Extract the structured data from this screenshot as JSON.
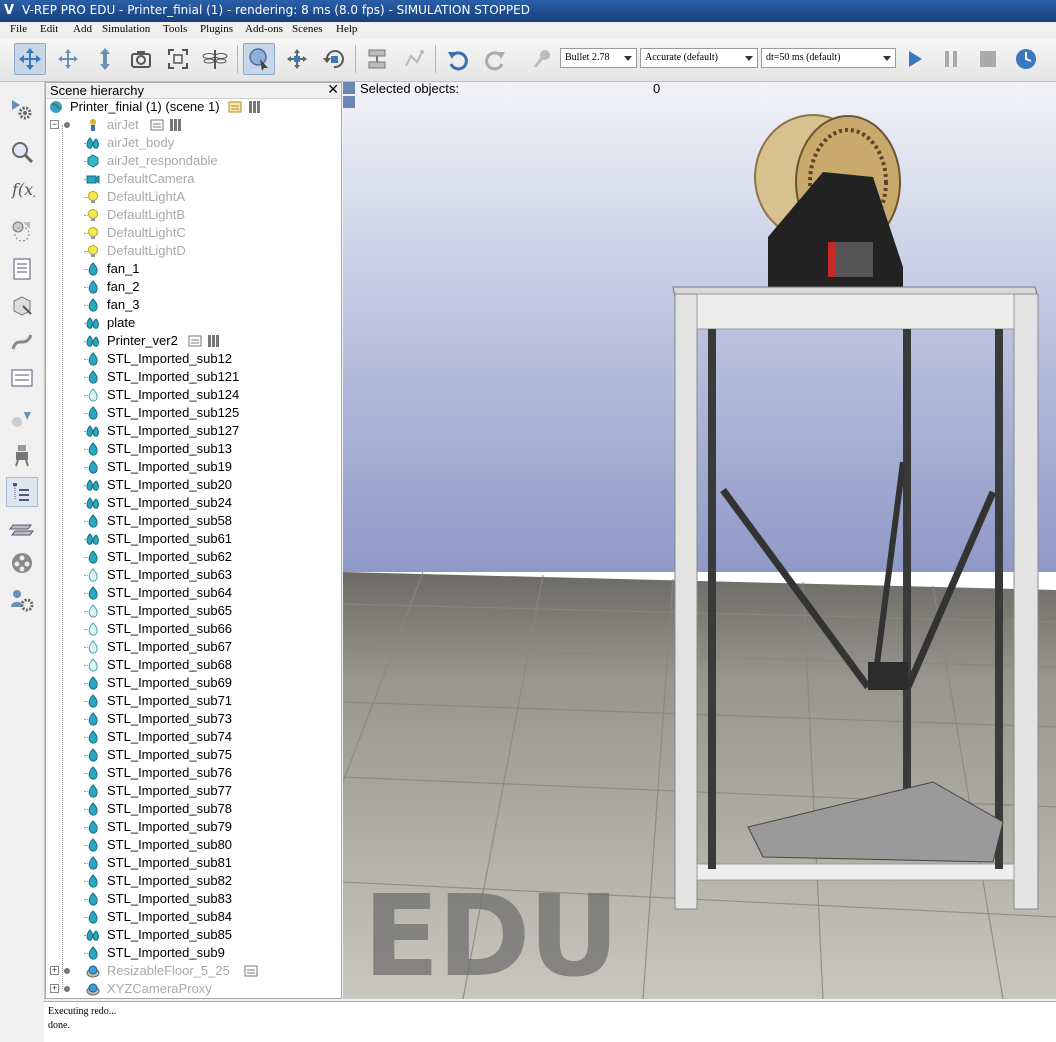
{
  "window": {
    "title": "V-REP PRO EDU - Printer_finial (1) - rendering: 8 ms (8.0 fps) - SIMULATION STOPPED"
  },
  "menu": [
    "File",
    "Edit",
    "Add",
    "Simulation",
    "Tools",
    "Plugins",
    "Add-ons",
    "Scenes",
    "Help"
  ],
  "toolbar": {
    "engine": "Bullet 2.78",
    "accuracy": "Accurate (default)",
    "timestep": "dt=50 ms (default)"
  },
  "hierarchy": {
    "title": "Scene hierarchy",
    "close": "✕",
    "scene_label": "Printer_finial (1) (scene 1)",
    "items": [
      {
        "name": "airJet",
        "icon": "dummy",
        "dim": true,
        "level": 1
      },
      {
        "name": "airJet_body",
        "icon": "shape-multi",
        "dim": true,
        "level": 2
      },
      {
        "name": "airJet_respondable",
        "icon": "cube",
        "dim": true,
        "level": 2
      },
      {
        "name": "DefaultCamera",
        "icon": "camera",
        "dim": true,
        "level": 2
      },
      {
        "name": "DefaultLightA",
        "icon": "light",
        "dim": true,
        "level": 2
      },
      {
        "name": "DefaultLightB",
        "icon": "light",
        "dim": true,
        "level": 2
      },
      {
        "name": "DefaultLightC",
        "icon": "light",
        "dim": true,
        "level": 2
      },
      {
        "name": "DefaultLightD",
        "icon": "light",
        "dim": true,
        "level": 2
      },
      {
        "name": "fan_1",
        "icon": "shape",
        "dim": false,
        "level": 2
      },
      {
        "name": "fan_2",
        "icon": "shape",
        "dim": false,
        "level": 2
      },
      {
        "name": "fan_3",
        "icon": "shape",
        "dim": false,
        "level": 2
      },
      {
        "name": "plate",
        "icon": "shape-multi",
        "dim": false,
        "level": 2
      },
      {
        "name": "Printer_ver2",
        "icon": "shape-multi",
        "dim": false,
        "level": 2
      },
      {
        "name": "STL_Imported_sub12",
        "icon": "shape",
        "dim": false,
        "level": 2
      },
      {
        "name": "STL_Imported_sub121",
        "icon": "shape",
        "dim": false,
        "level": 2
      },
      {
        "name": "STL_Imported_sub124",
        "icon": "shape-light",
        "dim": false,
        "level": 2
      },
      {
        "name": "STL_Imported_sub125",
        "icon": "shape",
        "dim": false,
        "level": 2
      },
      {
        "name": "STL_Imported_sub127",
        "icon": "shape-multi",
        "dim": false,
        "level": 2
      },
      {
        "name": "STL_Imported_sub13",
        "icon": "shape",
        "dim": false,
        "level": 2
      },
      {
        "name": "STL_Imported_sub19",
        "icon": "shape",
        "dim": false,
        "level": 2
      },
      {
        "name": "STL_Imported_sub20",
        "icon": "shape-multi",
        "dim": false,
        "level": 2
      },
      {
        "name": "STL_Imported_sub24",
        "icon": "shape-multi",
        "dim": false,
        "level": 2
      },
      {
        "name": "STL_Imported_sub58",
        "icon": "shape",
        "dim": false,
        "level": 2
      },
      {
        "name": "STL_Imported_sub61",
        "icon": "shape-multi",
        "dim": false,
        "level": 2
      },
      {
        "name": "STL_Imported_sub62",
        "icon": "shape",
        "dim": false,
        "level": 2
      },
      {
        "name": "STL_Imported_sub63",
        "icon": "shape-light",
        "dim": false,
        "level": 2
      },
      {
        "name": "STL_Imported_sub64",
        "icon": "shape",
        "dim": false,
        "level": 2
      },
      {
        "name": "STL_Imported_sub65",
        "icon": "shape-light",
        "dim": false,
        "level": 2
      },
      {
        "name": "STL_Imported_sub66",
        "icon": "shape-light",
        "dim": false,
        "level": 2
      },
      {
        "name": "STL_Imported_sub67",
        "icon": "shape-light",
        "dim": false,
        "level": 2
      },
      {
        "name": "STL_Imported_sub68",
        "icon": "shape-light",
        "dim": false,
        "level": 2
      },
      {
        "name": "STL_Imported_sub69",
        "icon": "shape",
        "dim": false,
        "level": 2
      },
      {
        "name": "STL_Imported_sub71",
        "icon": "shape",
        "dim": false,
        "level": 2
      },
      {
        "name": "STL_Imported_sub73",
        "icon": "shape",
        "dim": false,
        "level": 2
      },
      {
        "name": "STL_Imported_sub74",
        "icon": "shape",
        "dim": false,
        "level": 2
      },
      {
        "name": "STL_Imported_sub75",
        "icon": "shape",
        "dim": false,
        "level": 2
      },
      {
        "name": "STL_Imported_sub76",
        "icon": "shape",
        "dim": false,
        "level": 2
      },
      {
        "name": "STL_Imported_sub77",
        "icon": "shape",
        "dim": false,
        "level": 2
      },
      {
        "name": "STL_Imported_sub78",
        "icon": "shape",
        "dim": false,
        "level": 2
      },
      {
        "name": "STL_Imported_sub79",
        "icon": "shape",
        "dim": false,
        "level": 2
      },
      {
        "name": "STL_Imported_sub80",
        "icon": "shape",
        "dim": false,
        "level": 2
      },
      {
        "name": "STL_Imported_sub81",
        "icon": "shape",
        "dim": false,
        "level": 2
      },
      {
        "name": "STL_Imported_sub82",
        "icon": "shape",
        "dim": false,
        "level": 2
      },
      {
        "name": "STL_Imported_sub83",
        "icon": "shape",
        "dim": false,
        "level": 2
      },
      {
        "name": "STL_Imported_sub84",
        "icon": "shape",
        "dim": false,
        "level": 2
      },
      {
        "name": "STL_Imported_sub85",
        "icon": "shape-multi",
        "dim": false,
        "level": 2
      },
      {
        "name": "STL_Imported_sub9",
        "icon": "shape",
        "dim": false,
        "level": 2
      },
      {
        "name": "ResizableFloor_5_25",
        "icon": "floor",
        "dim": true,
        "level": 0
      },
      {
        "name": "XYZCameraProxy",
        "icon": "floor",
        "dim": true,
        "level": 0
      }
    ]
  },
  "viewport": {
    "selected_label": "Selected objects:",
    "selected_count": "0",
    "watermark": "EDU"
  },
  "status": [
    "Executing redo...",
    "done."
  ]
}
